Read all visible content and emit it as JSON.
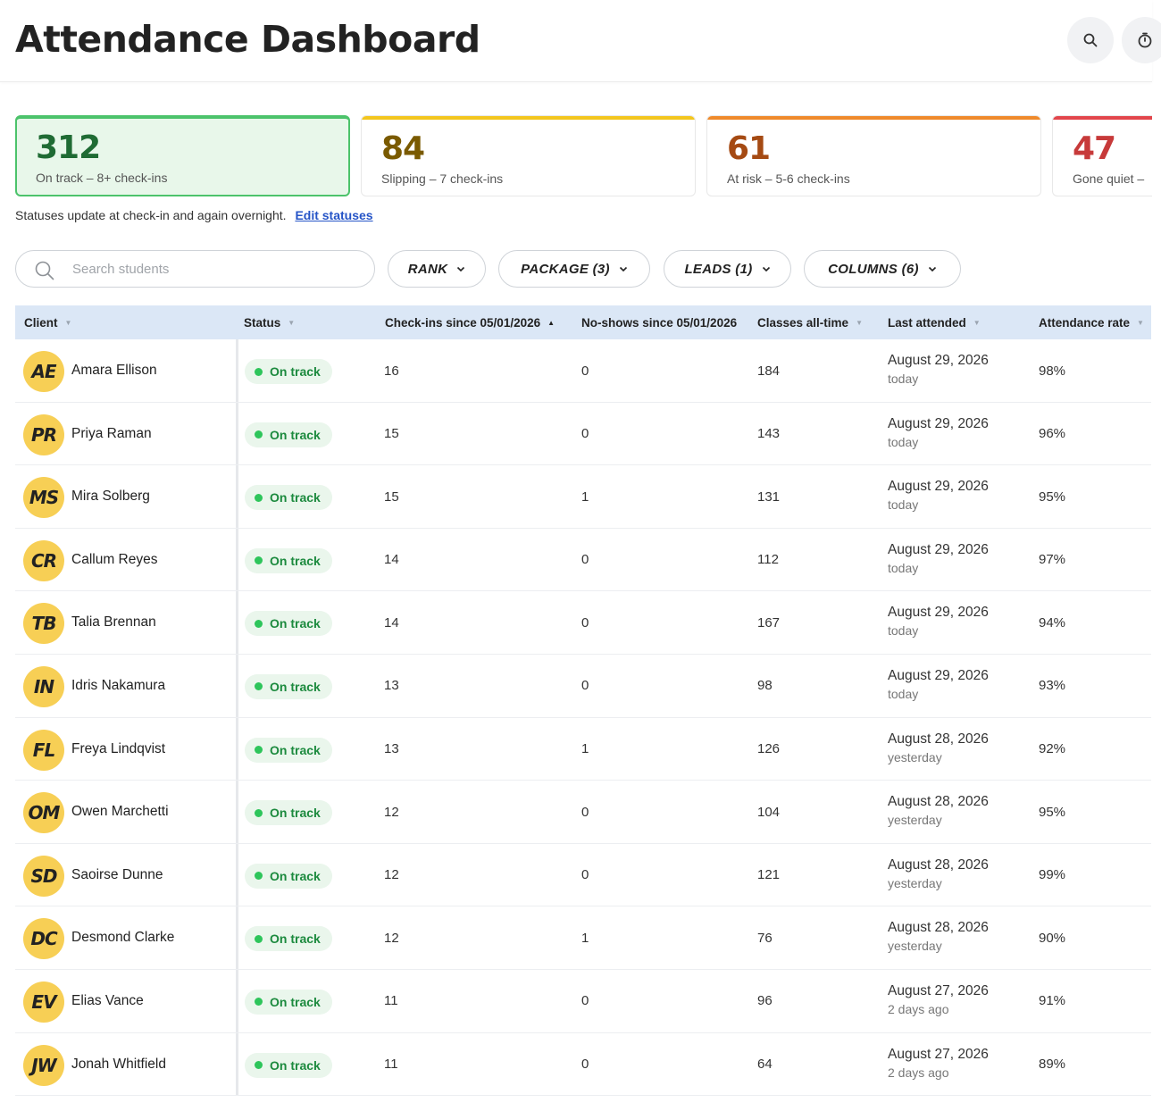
{
  "header": {
    "title": "Attendance Dashboard",
    "search_icon": "search-icon",
    "timer_icon": "timer-icon"
  },
  "cards": [
    {
      "value": "312",
      "label": "On track – 8+ check-ins",
      "color": "#1f6b34",
      "bar": "#4cc36b"
    },
    {
      "value": "84",
      "label": "Slipping – 7 check-ins",
      "color": "#7a5a00",
      "bar": "#f3c61e"
    },
    {
      "value": "61",
      "label": "At risk – 5-6 check-ins",
      "color": "#a54a13",
      "bar": "#ef8a2b"
    },
    {
      "value": "47",
      "label": "Gone quiet –",
      "color": "#c73a3a",
      "bar": "#e2464c"
    }
  ],
  "status_note": {
    "text": "Statuses update at check-in and again overnight.",
    "link": "Edit statuses"
  },
  "toolbar": {
    "search_placeholder": "Search students",
    "filters": [
      "RANK",
      "PACKAGE (3)",
      "LEADS (1)",
      "COLUMNS (6)"
    ]
  },
  "table": {
    "columns": [
      "Client",
      "Status",
      "Check-ins since 05/01/2026",
      "No-shows since 05/01/2026",
      "Classes all-time",
      "Last attended",
      "Attendance rate"
    ],
    "rows": [
      {
        "initials": "AE",
        "name": "Amara Ellison",
        "status": "On track",
        "checkins": "16",
        "noshows": "0",
        "classes": "184",
        "last_date": "August 29, 2026",
        "last_rel": "today",
        "rate": "98%"
      },
      {
        "initials": "PR",
        "name": "Priya Raman",
        "status": "On track",
        "checkins": "15",
        "noshows": "0",
        "classes": "143",
        "last_date": "August 29, 2026",
        "last_rel": "today",
        "rate": "96%"
      },
      {
        "initials": "MS",
        "name": "Mira Solberg",
        "status": "On track",
        "checkins": "15",
        "noshows": "1",
        "classes": "131",
        "last_date": "August 29, 2026",
        "last_rel": "today",
        "rate": "95%"
      },
      {
        "initials": "CR",
        "name": "Callum Reyes",
        "status": "On track",
        "checkins": "14",
        "noshows": "0",
        "classes": "112",
        "last_date": "August 29, 2026",
        "last_rel": "today",
        "rate": "97%"
      },
      {
        "initials": "TB",
        "name": "Talia Brennan",
        "status": "On track",
        "checkins": "14",
        "noshows": "0",
        "classes": "167",
        "last_date": "August 29, 2026",
        "last_rel": "today",
        "rate": "94%"
      },
      {
        "initials": "IN",
        "name": "Idris Nakamura",
        "status": "On track",
        "checkins": "13",
        "noshows": "0",
        "classes": "98",
        "last_date": "August 29, 2026",
        "last_rel": "today",
        "rate": "93%"
      },
      {
        "initials": "FL",
        "name": "Freya Lindqvist",
        "status": "On track",
        "checkins": "13",
        "noshows": "1",
        "classes": "126",
        "last_date": "August 28, 2026",
        "last_rel": "yesterday",
        "rate": "92%"
      },
      {
        "initials": "OM",
        "name": "Owen Marchetti",
        "status": "On track",
        "checkins": "12",
        "noshows": "0",
        "classes": "104",
        "last_date": "August 28, 2026",
        "last_rel": "yesterday",
        "rate": "95%"
      },
      {
        "initials": "SD",
        "name": "Saoirse Dunne",
        "status": "On track",
        "checkins": "12",
        "noshows": "0",
        "classes": "121",
        "last_date": "August 28, 2026",
        "last_rel": "yesterday",
        "rate": "99%"
      },
      {
        "initials": "DC",
        "name": "Desmond Clarke",
        "status": "On track",
        "checkins": "12",
        "noshows": "1",
        "classes": "76",
        "last_date": "August 28, 2026",
        "last_rel": "yesterday",
        "rate": "90%"
      },
      {
        "initials": "EV",
        "name": "Elias Vance",
        "status": "On track",
        "checkins": "11",
        "noshows": "0",
        "classes": "96",
        "last_date": "August 27, 2026",
        "last_rel": "2 days ago",
        "rate": "91%"
      },
      {
        "initials": "JW",
        "name": "Jonah Whitfield",
        "status": "On track",
        "checkins": "11",
        "noshows": "0",
        "classes": "64",
        "last_date": "August 27, 2026",
        "last_rel": "2 days ago",
        "rate": "89%"
      }
    ]
  }
}
